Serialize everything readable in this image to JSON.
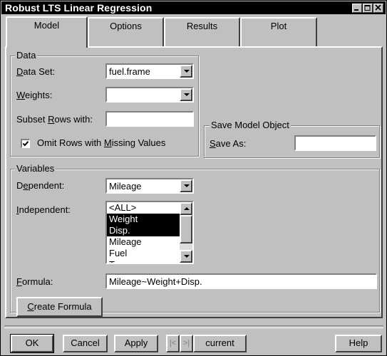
{
  "window": {
    "title": "Robust LTS Linear Regression",
    "controls": [
      "minimize",
      "maximize",
      "close"
    ]
  },
  "tabs": [
    {
      "label": "Model",
      "active": true
    },
    {
      "label": "Options",
      "active": false
    },
    {
      "label": "Results",
      "active": false
    },
    {
      "label": "Plot",
      "active": false
    }
  ],
  "data_group": {
    "title": "Data",
    "data_set_label": "Data Set:",
    "data_set_value": "fuel.frame",
    "weights_label": "Weights:",
    "weights_value": "",
    "subset_label": "Subset Rows with:",
    "subset_value": "",
    "omit_label": "Omit Rows with Missing Values",
    "omit_checked": true
  },
  "save_group": {
    "title": "Save Model Object",
    "save_as_label": "Save As:",
    "save_as_value": ""
  },
  "variables_group": {
    "title": "Variables",
    "dependent_label": "Dependent:",
    "dependent_value": "Mileage",
    "independent_label": "Independent:",
    "independent_items": [
      {
        "label": "<ALL>",
        "selected": false
      },
      {
        "label": "Weight",
        "selected": true
      },
      {
        "label": "Disp.",
        "selected": true
      },
      {
        "label": "Mileage",
        "selected": false
      },
      {
        "label": "Fuel",
        "selected": false
      },
      {
        "label": "Type",
        "selected": false
      }
    ],
    "formula_label": "Formula:",
    "formula_value": "Mileage~Weight+Disp.",
    "create_formula_label": "Create Formula"
  },
  "footer": {
    "ok_label": "OK",
    "cancel_label": "Cancel",
    "apply_label": "Apply",
    "prev_label": "|<",
    "next_label": ">|",
    "current_label": "current",
    "help_label": "Help"
  }
}
